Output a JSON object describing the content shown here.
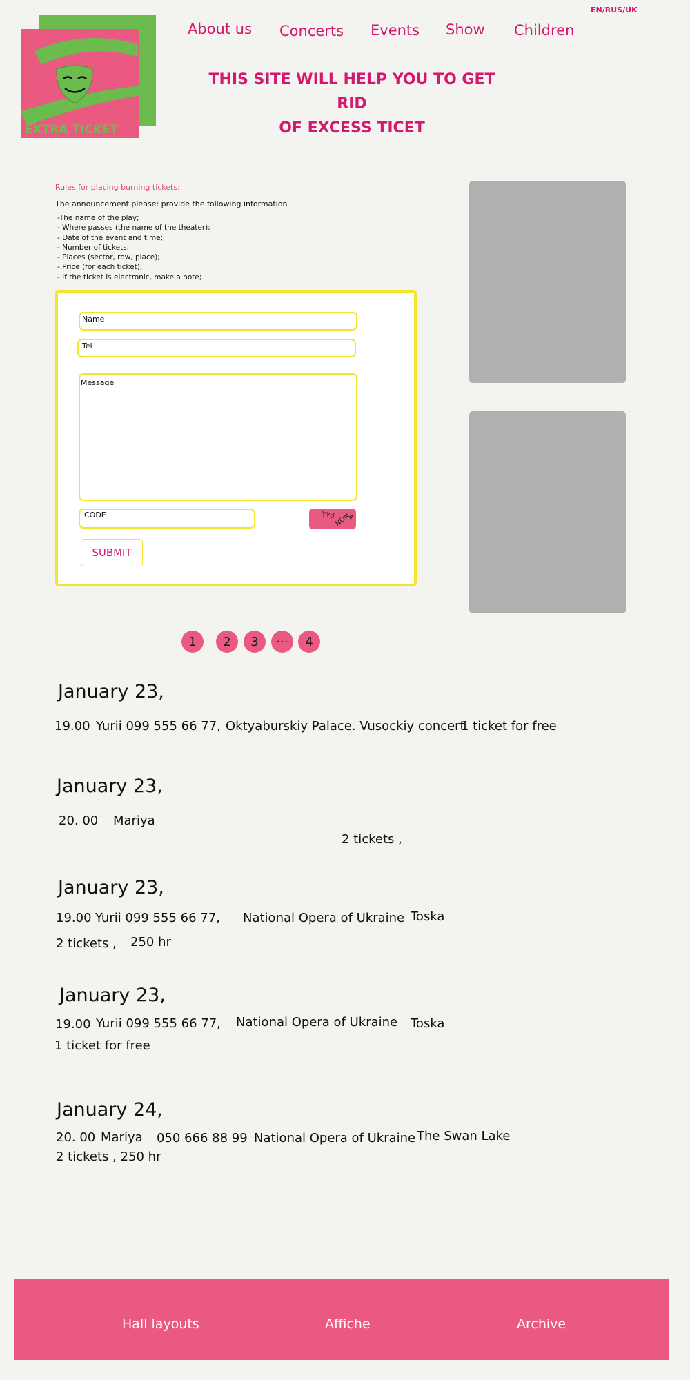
{
  "logo": {
    "text": "EXTRA TICKET",
    "icon": "theatre-mask-icon"
  },
  "lang_switch": "EN/RUS/UK",
  "nav": [
    "About us",
    "Concerts",
    "Events",
    "Show",
    "Children"
  ],
  "headline": [
    "THIS SITE WILL HELP YOU TO GET RID",
    "OF EXCESS TICET"
  ],
  "rules": {
    "title": "Rules for placing burning tickets:",
    "intro": "The announcement please: provide the following information",
    "items": [
      "-The name of the play;",
      "- Where passes (the name of the theater);",
      "- Date of the event and time;",
      "- Number of tickets;",
      "- Places (sector, row, place);",
      "- Price (for each ticket);",
      "- If the ticket is electronic, make a note;"
    ]
  },
  "form": {
    "name_label": "Name",
    "tel_label": "Tel",
    "message_label": "Message",
    "code_label": "CODE",
    "captcha_text": [
      "YYd",
      "NON",
      "A"
    ],
    "submit_label": "SUBMIT"
  },
  "pagination": [
    "1",
    "2",
    "3",
    "···",
    "4"
  ],
  "listings": [
    {
      "date": "January 23,",
      "time": "19.00",
      "contact": "Yurii 099 555 66 77,",
      "place": "Oktyaburskiy Palace. Vusockiy concert",
      "tickets": "1 ticket for free"
    },
    {
      "date": "January 23,",
      "time": "20. 00",
      "contact": "Mariya",
      "tickets": "2 tickets ,"
    },
    {
      "date": "January 23,",
      "time": "19.00",
      "contact": "Yurii 099 555 66 77,",
      "place": "National Opera of Ukraine",
      "show": "Toska",
      "tickets": "2 tickets ,",
      "price": "250 hr"
    },
    {
      "date": "January 23,",
      "time": "19.00",
      "contact": "Yurii 099 555 66 77,",
      "place": "National Opera of Ukraine",
      "show": "Toska",
      "tickets": "1 ticket for free"
    },
    {
      "date": "January 24,",
      "time": "20. 00",
      "contact": "Mariya",
      "phone": "050 666 88 99",
      "place": "National Opera of Ukraine",
      "show": "The Swan Lake",
      "tickets_price": "2 tickets , 250 hr"
    }
  ],
  "footer": [
    "Hall layouts",
    "Affiche",
    "Archive"
  ],
  "colors": {
    "brand_pink": "#ea5a80",
    "text_pink": "#d4176f",
    "brand_green": "#6bbb4e",
    "form_border": "#f5e52a",
    "ad_gray": "#b1b0b0",
    "background": "#f3f3ef"
  }
}
